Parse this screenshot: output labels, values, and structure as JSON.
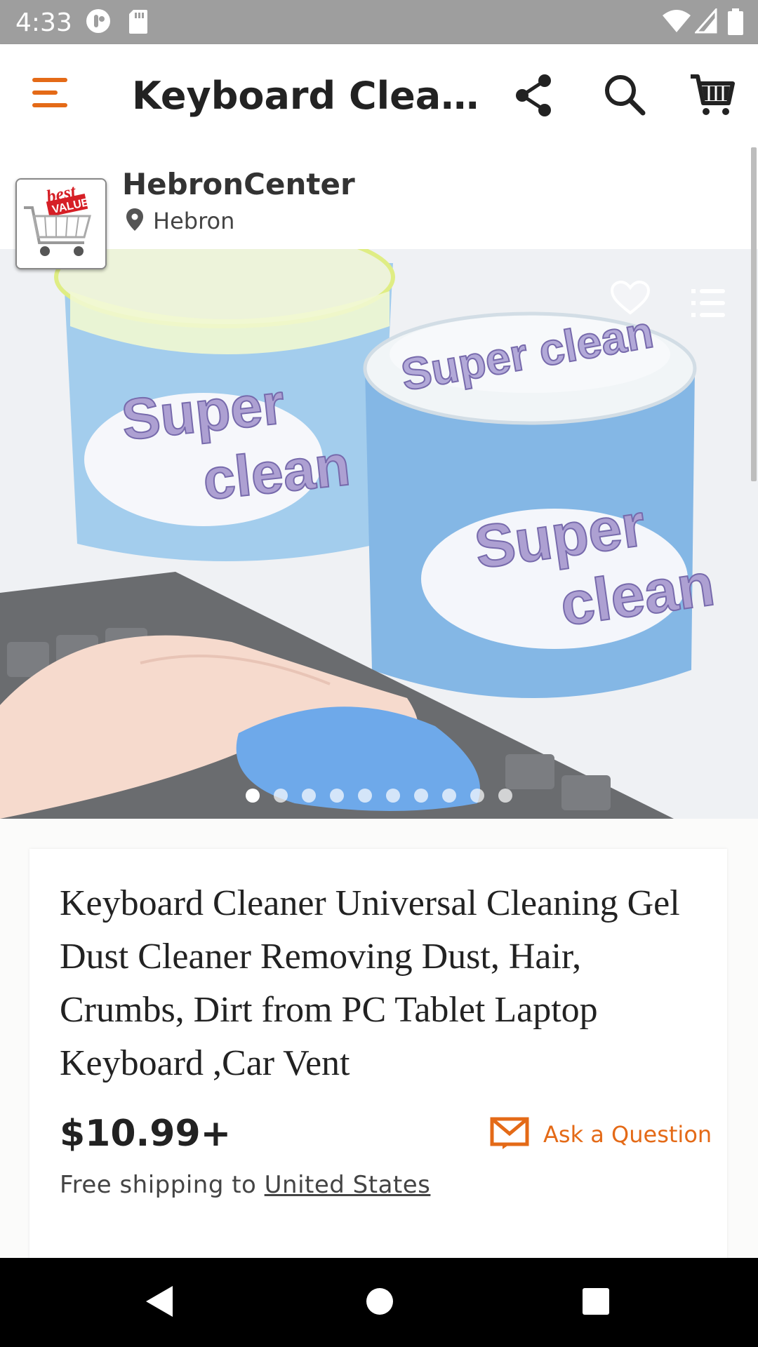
{
  "status_bar": {
    "time": "4:33"
  },
  "app_bar": {
    "title": "Keyboard Cleaner Universal Cleaning Gel",
    "menu_icon": "hamburger-menu-icon",
    "share_icon": "share-icon",
    "search_icon": "search-icon",
    "cart_icon": "cart-icon"
  },
  "shop": {
    "name": "HebronCenter",
    "location": "Hebron",
    "logo_text": "best"
  },
  "gallery": {
    "image_count": 10,
    "active_index": 0
  },
  "product": {
    "title": "Keyboard Cleaner Universal Cleaning Gel Dust Cleaner Removing Dust, Hair, Crumbs, Dirt from PC Tablet Laptop Keyboard ,Car Vent",
    "price": "$10.99+",
    "ask_label": "Ask a Question",
    "shipping_prefix": "Free shipping to ",
    "shipping_country": "United States"
  },
  "colors": {
    "accent": "#e46a17",
    "status_bar": "#9e9e9e",
    "nav_bar": "#000000"
  }
}
